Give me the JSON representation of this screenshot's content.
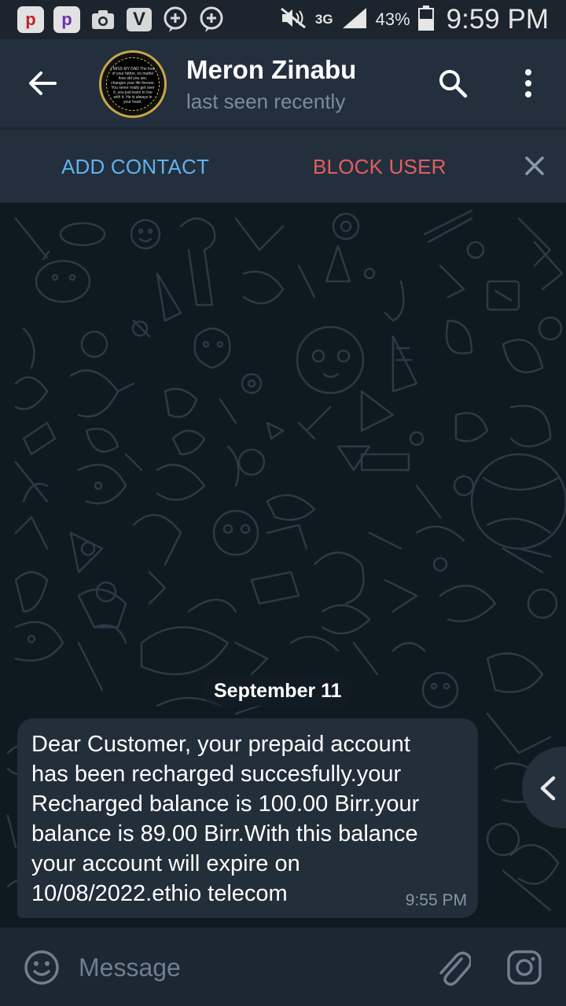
{
  "status_bar": {
    "network": "3G",
    "battery_percent": "43%",
    "time": "9:59 PM",
    "notification_icons": [
      "p-app-icon",
      "p-app-icon",
      "camera-icon",
      "v-app-icon",
      "add-circle-icon",
      "add-circle-icon"
    ]
  },
  "header": {
    "contact_name": "Meron Zinabu",
    "status": "last seen recently",
    "avatar_text": "I MISS MY DAD The loss of your father, no matter how old you are, changes your life forever. You never really get over it, you just learn to live with it. He is always in your heart."
  },
  "actions": {
    "add_contact": "ADD CONTACT",
    "block_user": "BLOCK USER"
  },
  "chat": {
    "date_label": "September 11",
    "messages": [
      {
        "text": "Dear Customer, your prepaid account\nhas been recharged succesfully.your\nRecharged balance is 100.00 Birr.your\nbalance is 89.00 Birr.With this balance\nyour account will expire on\n10/08/2022.ethio telecom",
        "time": "9:55 PM"
      }
    ]
  },
  "input": {
    "placeholder": "Message"
  },
  "colors": {
    "header_bg": "#242f3d",
    "chat_bg": "#0f1920",
    "bubble_bg": "#222e3a",
    "accent_blue": "#5fb3ee",
    "accent_red": "#e35e5e",
    "secondary_text": "#7b8c9e"
  }
}
